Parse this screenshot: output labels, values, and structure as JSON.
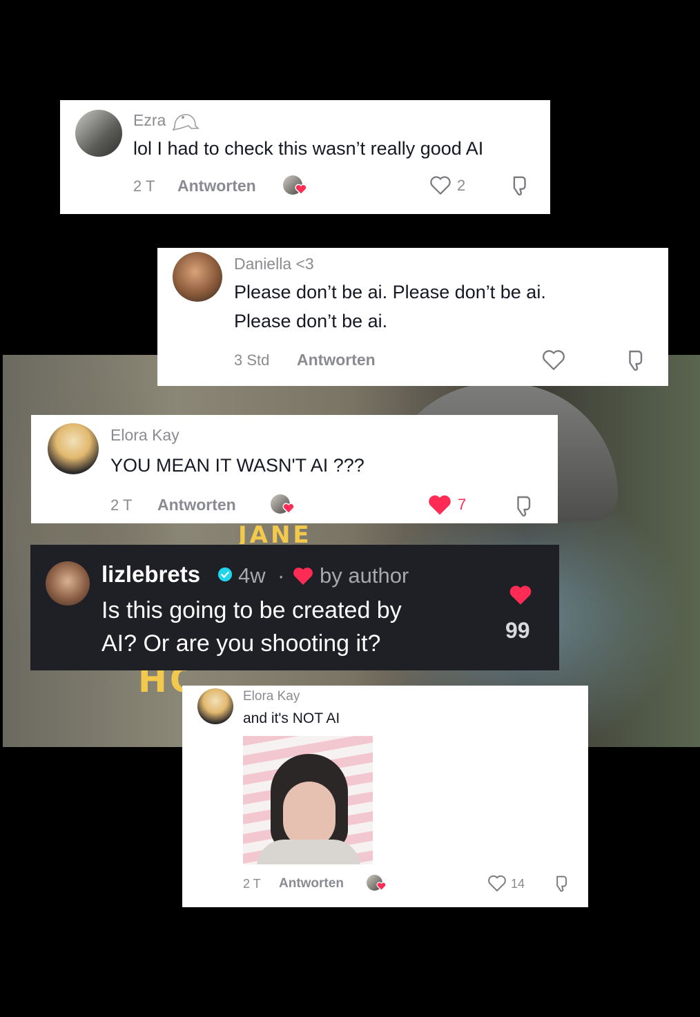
{
  "comments": [
    {
      "name": "Ezra",
      "name_icon": "frog-icon",
      "text": "lol I had to check this wasn’t really good AI",
      "time": "2 T",
      "reply_label": "Antworten",
      "creator_liked": true,
      "likes": "2",
      "liked": false
    },
    {
      "name": "Daniella <3",
      "text_lines": [
        "Please don’t be ai. Please don’t be ai.",
        "Please don’t be ai."
      ],
      "time": "3 Std",
      "reply_label": "Antworten",
      "creator_liked": false,
      "likes": "",
      "liked": false
    },
    {
      "name": "Elora Kay",
      "text": "YOU MEAN IT WASN'T AI ???",
      "time": "2 T",
      "reply_label": "Antworten",
      "creator_liked": true,
      "likes": "7",
      "liked": true
    },
    {
      "name": "lizlebrets",
      "verified": true,
      "age": "4w",
      "separator": "·",
      "creator_tag": "by author",
      "text_lines": [
        "Is this going to be created by",
        "AI? Or are you shooting it?"
      ],
      "likes": "99",
      "liked": true,
      "theme": "dark"
    },
    {
      "name": "Elora Kay",
      "text": "and it's NOT AI",
      "has_image": true,
      "time": "2 T",
      "reply_label": "Antworten",
      "creator_liked": true,
      "likes": "14",
      "liked": false
    }
  ],
  "colors": {
    "heart_red": "#fe2c55",
    "muted_gray": "#8a8b91",
    "text_dark": "#161823",
    "dark_card": "#1f1f26",
    "title_yellow": "#f2c94c"
  }
}
